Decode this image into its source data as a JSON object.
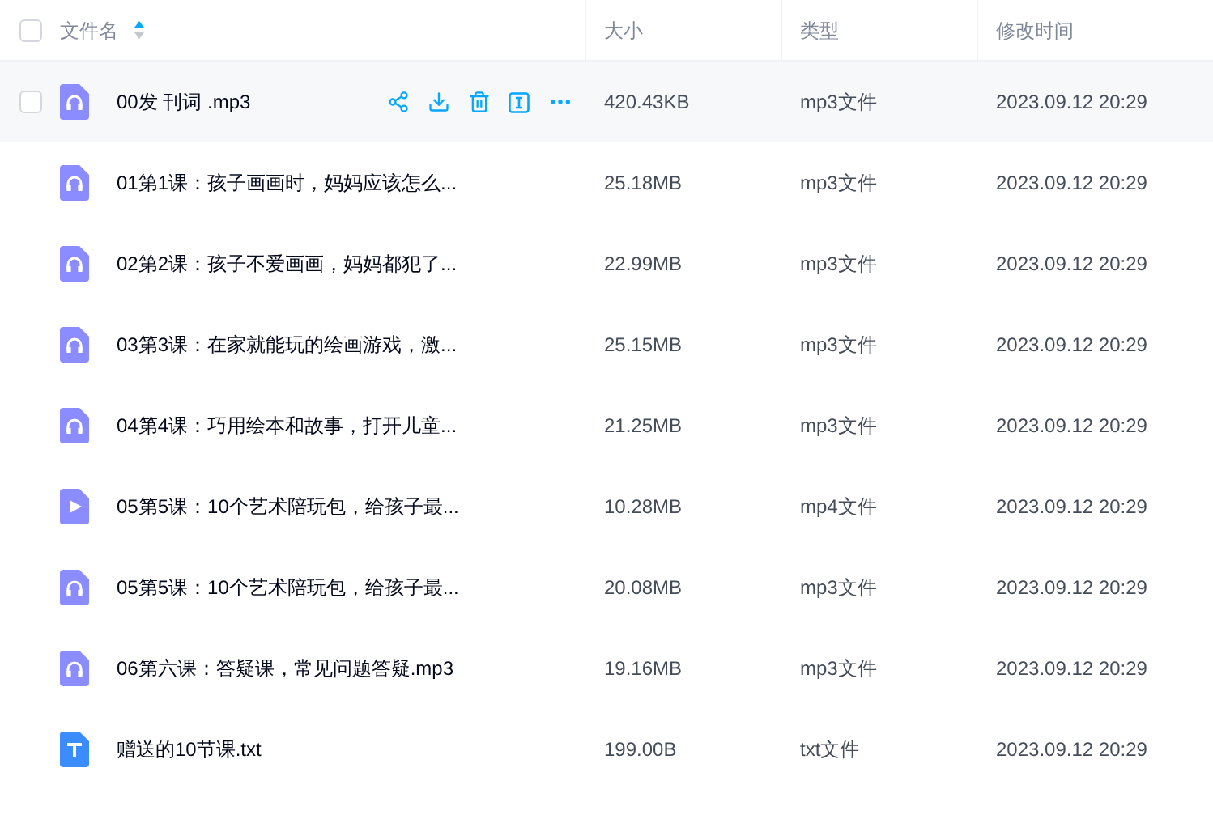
{
  "table": {
    "all_checked": false,
    "columns": [
      {
        "label": "文件名",
        "sorted_ascending": true
      },
      {
        "label": "大小"
      },
      {
        "label": "类型"
      },
      {
        "label": "修改时间"
      }
    ],
    "rows": [
      {
        "kind": "audio",
        "name": "00发 刊词 .mp3",
        "size": "420.43KB",
        "type": "mp3文件",
        "modified": "2023.09.12 20:29",
        "hovered": true,
        "checked": false
      },
      {
        "kind": "audio",
        "name": "01第1课：孩子画画时，妈妈应该怎么...",
        "size": "25.18MB",
        "type": "mp3文件",
        "modified": "2023.09.12 20:29",
        "hovered": false,
        "checked": false
      },
      {
        "kind": "audio",
        "name": "02第2课：孩子不爱画画，妈妈都犯了...",
        "size": "22.99MB",
        "type": "mp3文件",
        "modified": "2023.09.12 20:29",
        "hovered": false,
        "checked": false
      },
      {
        "kind": "audio",
        "name": "03第3课：在家就能玩的绘画游戏，激...",
        "size": "25.15MB",
        "type": "mp3文件",
        "modified": "2023.09.12 20:29",
        "hovered": false,
        "checked": false
      },
      {
        "kind": "audio",
        "name": "04第4课：巧用绘本和故事，打开儿童...",
        "size": "21.25MB",
        "type": "mp3文件",
        "modified": "2023.09.12 20:29",
        "hovered": false,
        "checked": false
      },
      {
        "kind": "video",
        "name": "05第5课：10个艺术陪玩包，给孩子最...",
        "size": "10.28MB",
        "type": "mp4文件",
        "modified": "2023.09.12 20:29",
        "hovered": false,
        "checked": false
      },
      {
        "kind": "audio",
        "name": "05第5课：10个艺术陪玩包，给孩子最...",
        "size": "20.08MB",
        "type": "mp3文件",
        "modified": "2023.09.12 20:29",
        "hovered": false,
        "checked": false
      },
      {
        "kind": "audio",
        "name": "06第六课：答疑课，常见问题答疑.mp3",
        "size": "19.16MB",
        "type": "mp3文件",
        "modified": "2023.09.12 20:29",
        "hovered": false,
        "checked": false
      },
      {
        "kind": "text",
        "name": "赠送的10节课.txt",
        "size": "199.00B",
        "type": "txt文件",
        "modified": "2023.09.12 20:29",
        "hovered": false,
        "checked": false
      }
    ]
  }
}
